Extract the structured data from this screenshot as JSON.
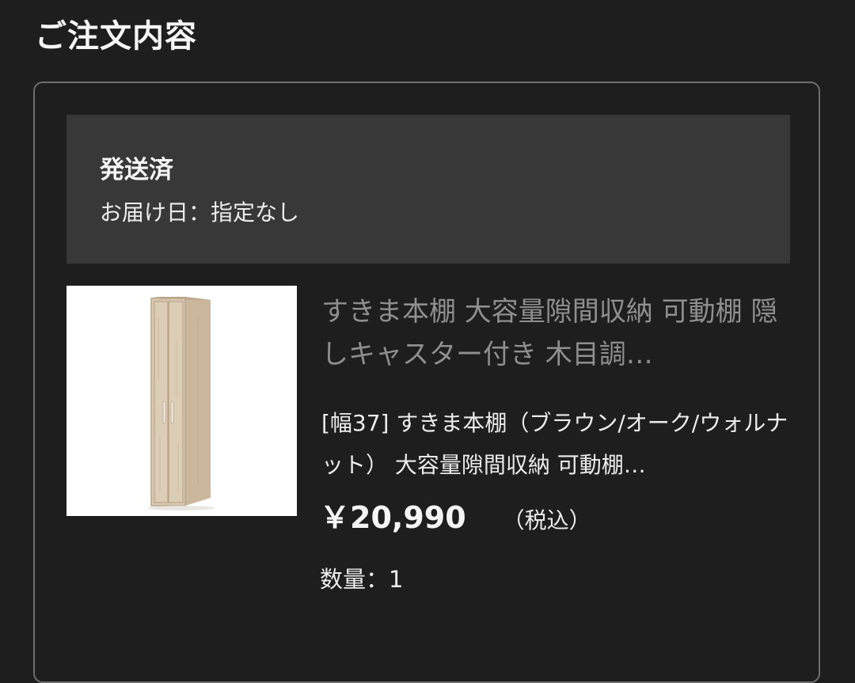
{
  "section": {
    "title": "ご注文内容"
  },
  "order": {
    "status": "発送済",
    "delivery_date": "お届け日：指定なし",
    "product": {
      "name": "すきま本棚 大容量隙間収納 可動棚 隠しキャスター付き 木目調…",
      "variant": "[幅37] すきま本棚（ブラウン/オーク/ウォルナット） 大容量隙間収納 可動棚…",
      "price": "￥20,990",
      "tax_note": "（税込）",
      "quantity": "数量：1",
      "image_icon": "tall-wooden-cabinet"
    }
  },
  "colors": {
    "background": "#1e1e1e",
    "status_box": "#383838",
    "card_border": "#6e6e6e",
    "product_name": "#8f8f8f",
    "cabinet_wood": "#d9c9b2"
  }
}
